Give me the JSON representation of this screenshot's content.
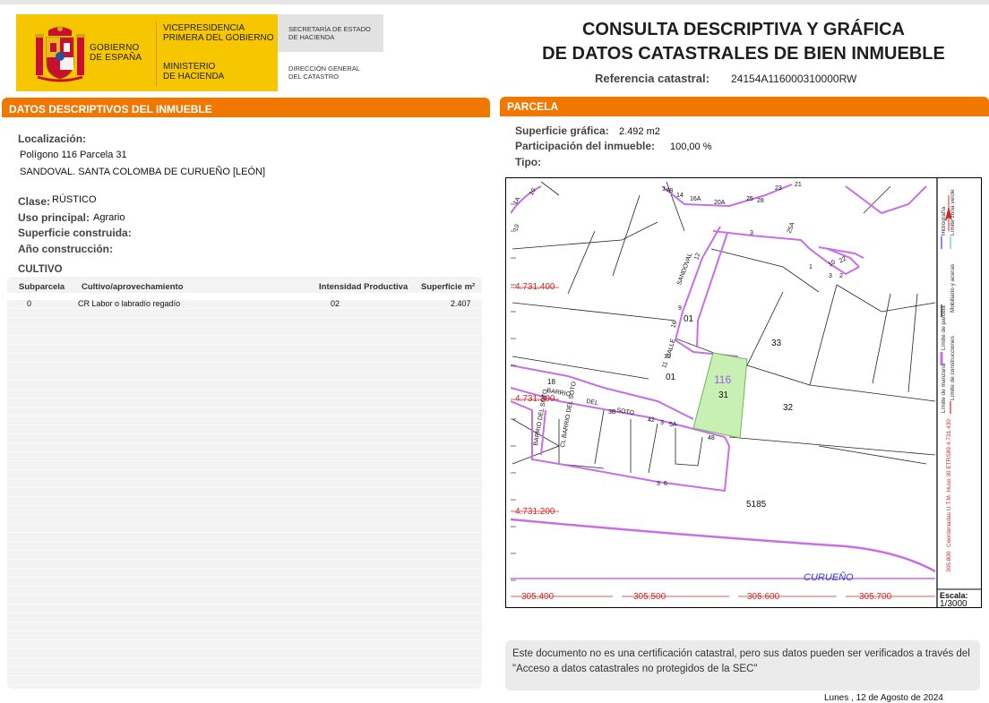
{
  "header": {
    "gov_line1": "GOBIERNO",
    "gov_line2": "DE ESPAÑA",
    "vice_line1": "VICEPRESIDENCIA",
    "vice_line2": "PRIMERA DEL GOBIERNO",
    "ministry_line1": "MINISTERIO",
    "ministry_line2": "DE HACIENDA",
    "sec_line1": "SECRETARÍA DE ESTADO",
    "sec_line2": "DE HACIENDA",
    "dg_line1": "DIRECCIÓN GENERAL",
    "dg_line2": "DEL CATASTRO",
    "title_line1": "CONSULTA DESCRIPTIVA Y GRÁFICA",
    "title_line2": "DE DATOS CATASTRALES DE BIEN INMUEBLE",
    "ref_label": "Referencia catastral:",
    "ref_value": "24154A116000310000RW"
  },
  "left": {
    "section_title": "DATOS DESCRIPTIVOS DEL INMUEBLE",
    "loc_label": "Localización:",
    "loc_line1": "Polígono 116 Parcela 31",
    "loc_line2": "SANDOVAL. SANTA COLOMBA DE CURUEÑO [LEÓN]",
    "clase_label": "Clase:",
    "clase_value": "RÚSTICO",
    "uso_label": "Uso principal:",
    "uso_value": "Agrario",
    "sup_label": "Superficie construida:",
    "anio_label": "Año construcción:",
    "cultivo_title": "CULTIVO",
    "table": {
      "headers": [
        "Subparcela",
        "Cultivo/aprovechamiento",
        "Intensidad Productiva",
        "Superficie m²"
      ],
      "rows": [
        [
          "0",
          "CR Labor o labradío regadío",
          "02",
          "2.407"
        ]
      ]
    }
  },
  "right": {
    "section_title": "PARCELA",
    "sup_label": "Superficie gráfica:",
    "sup_value": "2.492 m2",
    "part_label": "Participación del inmueble:",
    "part_value": "100,00 %",
    "tipo_label": "Tipo:",
    "map": {
      "y_ticks": [
        "4.731.400",
        "4.731.300",
        "4.731.200"
      ],
      "x_ticks": [
        "305.400",
        "305.500",
        "305.600",
        "305.700"
      ],
      "poligono": "116",
      "parcela_main": "31",
      "parcels": [
        "01",
        "01",
        "33",
        "32",
        "5185"
      ],
      "river": "CURUEÑO",
      "streets": [
        "SANDOVAL",
        "CALLE",
        "BARRIO",
        "DEL",
        "SOTO",
        "CL BARRIO DEL SOTO",
        "BARRIO DEL SOTO"
      ],
      "house_numbers": [
        "14B",
        "14",
        "16A",
        "20A",
        "25",
        "28",
        "23",
        "21",
        "3",
        "25A",
        "12",
        "9",
        "16",
        "11",
        "15",
        "1",
        "10",
        "22",
        "3",
        "2",
        "42",
        "3",
        "5A",
        "48",
        "3",
        "6",
        "18",
        "3B",
        "1A",
        "10",
        "10"
      ],
      "legend": [
        "Límite de manzana",
        "Límite de parcela",
        "Límite de construcciones",
        "Mobiliario y aceras",
        "Límite zona verde",
        "Hidrografía"
      ],
      "coord_note": "Coordenadas U.T.M. Huso 30 ETRS89",
      "coord_left": "305.800",
      "coord_right": "4.731.430",
      "scale_label": "Escala:",
      "scale_value": "1/3000"
    }
  },
  "notice": "Este documento no es una certificación catastral, pero sus datos pueden ser verificados a través del \"Acceso a datos catastrales no protegidos de la SEC\"",
  "date": "Lunes , 12 de Agosto de 2024",
  "colors": {
    "orange": "#F07800",
    "gov_yellow": "#F6C600",
    "parcel_green": "#C8F0B4",
    "manzana_purple": "#C86EE6",
    "coord_red": "#D22828",
    "river_blue": "#3040C0"
  }
}
